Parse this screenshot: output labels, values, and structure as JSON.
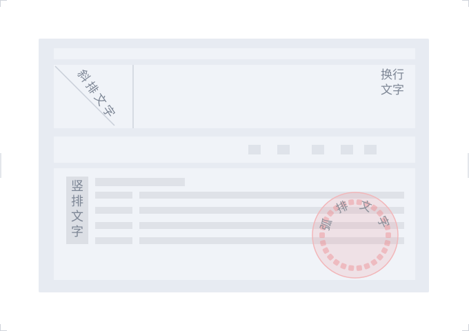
{
  "slanted_text": "斜排文字",
  "wrapped_text_line1": "换行",
  "wrapped_text_line2": "文字",
  "vertical_text": [
    "竖",
    "排",
    "文",
    "字"
  ],
  "stamp": {
    "arc_text": [
      "弧",
      "排",
      "文",
      "字"
    ],
    "color": "#ee8e93"
  },
  "colors": {
    "card": "#e7ebf2",
    "panel": "#f0f3f8",
    "placeholder": "#dfe2e8",
    "text": "#7d8695"
  }
}
